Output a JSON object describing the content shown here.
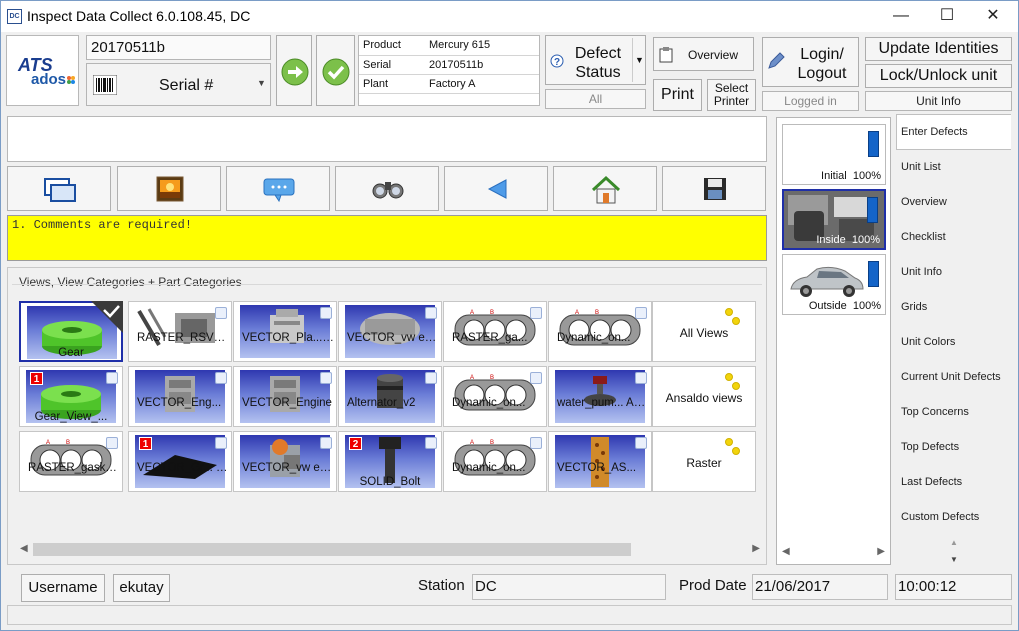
{
  "window": {
    "title": "Inspect Data Collect 6.0.108.45, DC",
    "app_icon": "DC"
  },
  "header": {
    "logo_top": "ATS",
    "logo_bottom": "ados",
    "serial_value": "20170511b",
    "serial_type_label": "Serial #",
    "info": [
      {
        "key": "Product",
        "value": "Mercury 615"
      },
      {
        "key": "Serial",
        "value": "20170511b"
      },
      {
        "key": "Plant",
        "value": "Factory A"
      }
    ],
    "defect_status_label": "Defect Status",
    "defect_status_filter": "All",
    "overview_label": "Overview",
    "print_label": "Print",
    "select_printer_label": "Select Printer",
    "login_logout_label": "Login/ Logout",
    "logged_in_label": "Logged in",
    "update_identities_label": "Update Identities",
    "lock_unlock_label": "Lock/Unlock unit",
    "unit_info_label": "Unit Info"
  },
  "message": {
    "text": "1. Comments are required!"
  },
  "views_panel": {
    "title": "Views, View Categories + Part Categories",
    "rows": [
      [
        {
          "label": "Gear",
          "type": "gear",
          "selected": true
        },
        {
          "label": "RASTER_RSVR engine",
          "type": "engine-white"
        },
        {
          "label": "VECTOR_Pla... gearbox",
          "type": "gearbox"
        },
        {
          "label": "VECTOR_vw engine.STEP",
          "type": "engine2"
        },
        {
          "label": "RASTER_ga...",
          "type": "gasket"
        },
        {
          "label": "Dynamic_on...",
          "type": "gasket"
        }
      ],
      [
        {
          "label": "Gear_View_...",
          "type": "gear",
          "badge": "1"
        },
        {
          "label": "VECTOR_Eng...",
          "type": "engine3"
        },
        {
          "label": "VECTOR_Engine",
          "type": "engine3"
        },
        {
          "label": "Alternator_v2",
          "type": "alternator"
        },
        {
          "label": "Dynamic_on...",
          "type": "gasket"
        },
        {
          "label": "water_pum... ASSEMBLY",
          "type": "pump"
        }
      ],
      [
        {
          "label": "RASTER_gasket AB",
          "type": "gasket-green"
        },
        {
          "label": "VECTOR_Gr... Launcher",
          "type": "launcher",
          "badge": "1"
        },
        {
          "label": "VECTOR_vw engine.SLDASM",
          "type": "engine-orange"
        },
        {
          "label": "SOLID_Bolt",
          "type": "bolt",
          "badge": "2"
        },
        {
          "label": "Dynamic_on...",
          "type": "gasket"
        },
        {
          "label": "VECTOR_AS...",
          "type": "assembly"
        }
      ]
    ],
    "categories": [
      "All Views",
      "Ansaldo views",
      "Raster"
    ]
  },
  "view_list": [
    {
      "label": "Initial",
      "percent": "100%"
    },
    {
      "label": "Inside",
      "percent": "100%"
    },
    {
      "label": "Outside",
      "percent": "100%"
    }
  ],
  "tabs": [
    "Enter Defects",
    "Unit List",
    "Overview",
    "Checklist",
    "Unit Info",
    "Grids",
    "Unit Colors",
    "Current Unit Defects",
    "Top Concerns",
    "Top Defects",
    "Last Defects",
    "Custom Defects"
  ],
  "statusbar": {
    "username_label": "Username",
    "username_value": "ekutay",
    "station_label": "Station",
    "station_value": "DC",
    "prod_date_label": "Prod Date",
    "prod_date_value": "21/06/2017",
    "time_value": "10:00:12"
  },
  "colors": {
    "message_bg": "#ffff00",
    "selection": "#1f2fa8",
    "thumb_blue": "#2f38b0",
    "accent_green": "#7cc04a"
  }
}
